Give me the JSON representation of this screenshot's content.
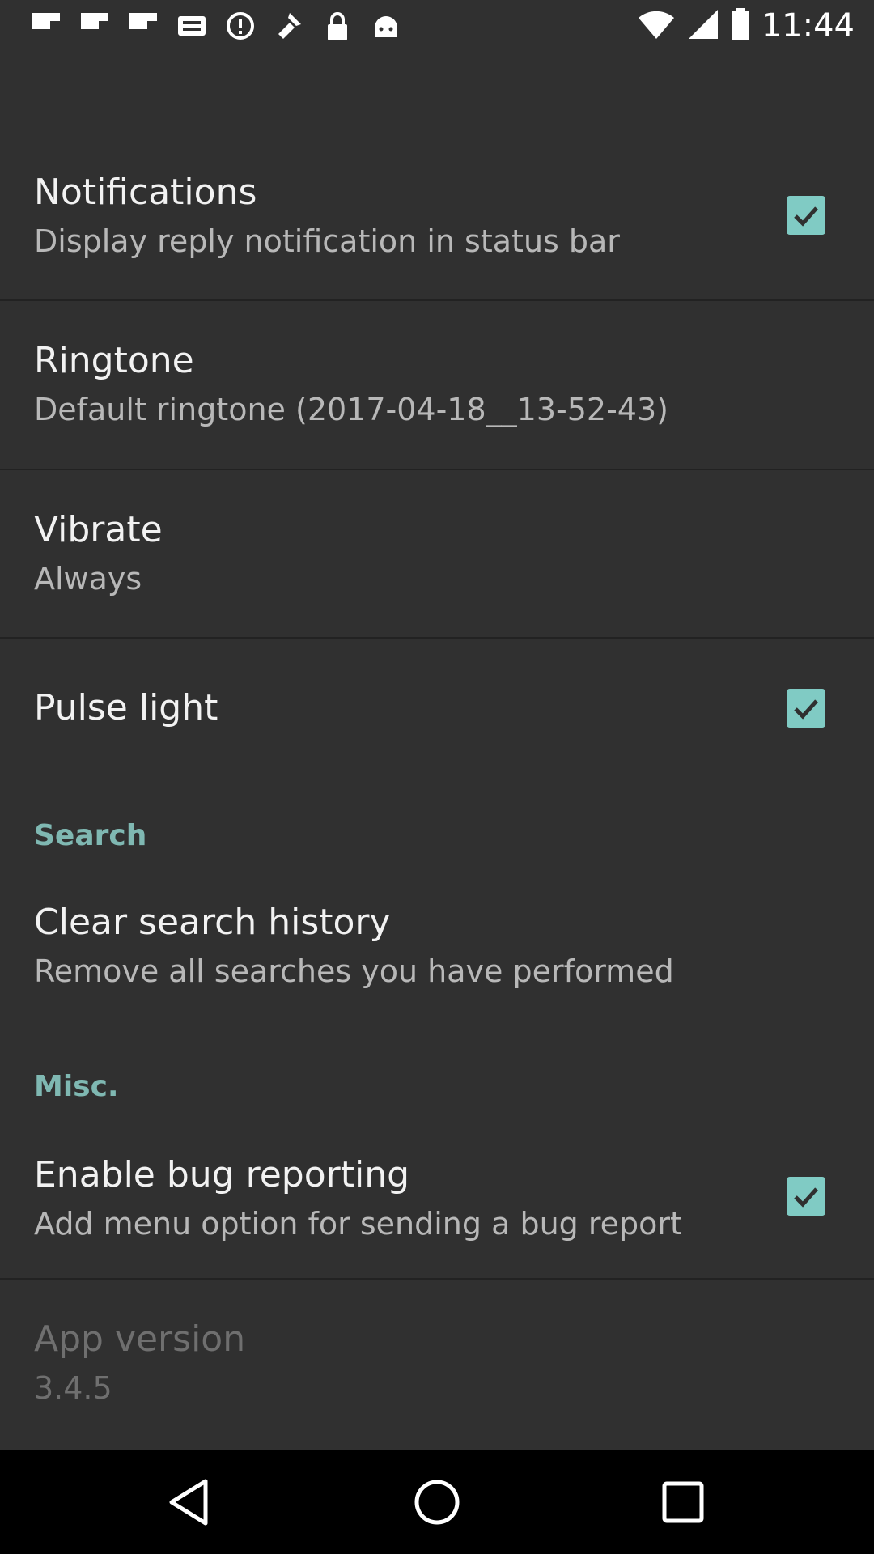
{
  "status_bar": {
    "time": "11:44",
    "icons": [
      "flipboard-icon",
      "flipboard-icon",
      "flipboard-icon",
      "inbox-icon",
      "alert-icon",
      "fake-gps-icon",
      "lock-icon",
      "android-icon",
      "wifi-icon",
      "signal-icon",
      "battery-icon"
    ]
  },
  "settings": {
    "notifications": {
      "title": "Notifications",
      "summary": "Display reply notification in status bar",
      "checked": true
    },
    "ringtone": {
      "title": "Ringtone",
      "summary": "Default ringtone (2017-04-18__13-52-43)"
    },
    "vibrate": {
      "title": "Vibrate",
      "summary": "Always"
    },
    "pulse_light": {
      "title": "Pulse light",
      "checked": true
    },
    "search_section": {
      "header": "Search"
    },
    "clear_search_history": {
      "title": "Clear search history",
      "summary": "Remove all searches you have performed"
    },
    "misc_section": {
      "header": "Misc."
    },
    "enable_bug_reporting": {
      "title": "Enable bug reporting",
      "summary": "Add menu option for sending a bug report",
      "checked": true
    },
    "app_version": {
      "title": "App version",
      "summary": "3.4.5"
    }
  },
  "colors": {
    "background": "#303030",
    "accent": "#80cbc4",
    "section_header": "#7fb8b2",
    "nav_bar": "#000000"
  },
  "nav_bar": {
    "buttons": [
      "back-icon",
      "home-icon",
      "recents-icon"
    ]
  }
}
